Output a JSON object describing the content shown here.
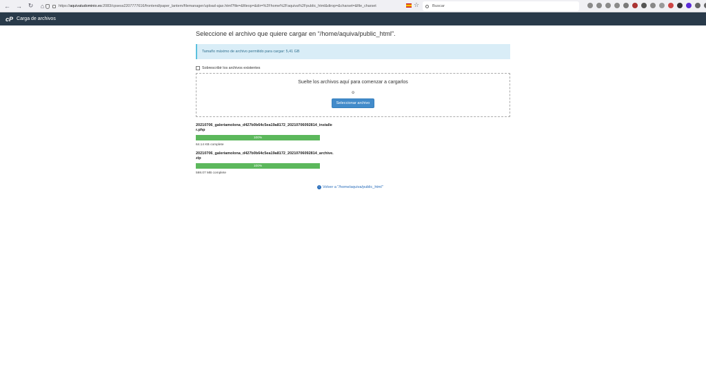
{
  "browser": {
    "url_prefix": "https://",
    "url_domain": "aquivatudominio.es",
    "url_rest": ":2083/cpsess2207777616/frontend/paper_lantern/filemanager/upload-ajax.html?file=&fileop=&dir=%2Fhome%2Faquiva%2Fpublic_html&dirop=&charset=&file_charset",
    "search_placeholder": "Buscar"
  },
  "header": {
    "logo": "cP",
    "title": "Carga de archivos"
  },
  "main": {
    "title": "Seleccione el archivo que quiere cargar en “/home/aquiva/public_html”.",
    "max_size_info": "Tamaño máximo de archivo permitido para cargar: 5,41 GB",
    "overwrite_label": "Sobrescribir los archivos existentes",
    "drop_text": "Suelte los archivos aquí para comenzar a cargarlos",
    "or_text": "o",
    "select_button": "Seleccionar archivo"
  },
  "uploads": [
    {
      "file_name": "20210706_galeriamolona_d427b0b64c5ea19a8172_20210706092814_installer.php",
      "progress_label": "100%",
      "progress": 1.0,
      "status": "64.14 KB complete"
    },
    {
      "file_name": "20210706_galeriamolona_d427b0b64c5ea19a8172_20210706092814_archive.zip",
      "progress_label": "100%",
      "progress": 1.0,
      "status": "598.07 MB complete"
    }
  ],
  "back_link": "Volver a \"/home/aquiva/public_html\""
}
